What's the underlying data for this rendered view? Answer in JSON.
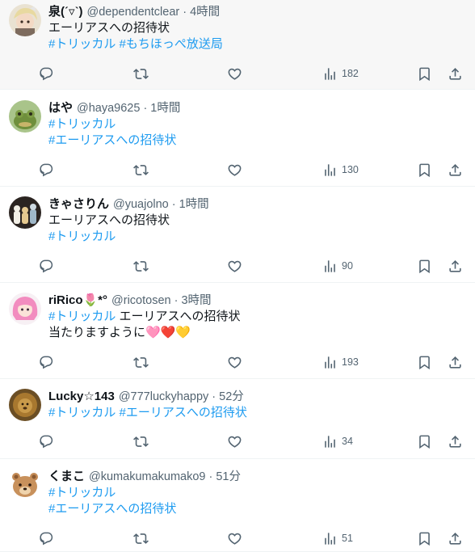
{
  "colors": {
    "link": "#1d9bf0",
    "muted": "#536471",
    "text": "#0f1419"
  },
  "tweets": [
    {
      "name": "泉(ˊ▿ˋ)",
      "handle": "@dependentclear",
      "time": "4時間",
      "lines": [
        [
          {
            "text": "エーリアスへの招待状"
          }
        ],
        [
          {
            "text": "#トリッカル",
            "tag": true
          },
          {
            "text": " "
          },
          {
            "text": "#もちほっぺ放送局",
            "tag": true
          }
        ]
      ],
      "views": "182",
      "avatar_icon": "anime-girl-avatar"
    },
    {
      "name": "はや",
      "handle": "@haya9625",
      "time": "1時間",
      "lines": [
        [
          {
            "text": "#トリッカル",
            "tag": true
          }
        ],
        [
          {
            "text": "#エーリアスへの招待状",
            "tag": true
          }
        ]
      ],
      "views": "130",
      "avatar_icon": "frog-avatar"
    },
    {
      "name": "きゃさりん",
      "handle": "@yuajolno",
      "time": "1時間",
      "lines": [
        [
          {
            "text": "エーリアスへの招待状"
          }
        ],
        [
          {
            "text": "#トリッカル",
            "tag": true
          }
        ]
      ],
      "views": "90",
      "avatar_icon": "figures-avatar"
    },
    {
      "name": "riRico🌷*°",
      "handle": "@ricotosen",
      "time": "3時間",
      "lines": [
        [
          {
            "text": "#トリッカル",
            "tag": true
          },
          {
            "text": " エーリアスへの招待状"
          }
        ],
        [
          {
            "text": "当たりますように🩷❤️💛"
          }
        ]
      ],
      "views": "193",
      "avatar_icon": "pink-hair-avatar"
    },
    {
      "name": "Lucky☆143",
      "handle": "@777luckyhappy",
      "time": "52分",
      "lines": [
        [
          {
            "text": "#トリッカル",
            "tag": true
          },
          {
            "text": " "
          },
          {
            "text": "#エーリアスへの招待状",
            "tag": true
          }
        ]
      ],
      "views": "34",
      "avatar_icon": "lion-avatar"
    },
    {
      "name": "くまこ",
      "handle": "@kumakumakumako9",
      "time": "51分",
      "lines": [
        [
          {
            "text": "#トリッカル",
            "tag": true
          }
        ],
        [
          {
            "text": "#エーリアスへの招待状",
            "tag": true
          }
        ]
      ],
      "views": "51",
      "avatar_icon": "bear-avatar"
    }
  ]
}
